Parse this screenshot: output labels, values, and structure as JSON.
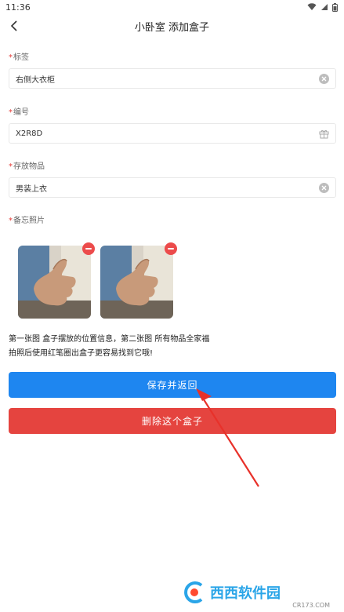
{
  "status": {
    "time": "11:36"
  },
  "header": {
    "title": "小卧室 添加盒子"
  },
  "form": {
    "required_mark": "*",
    "tag": {
      "label": "标签",
      "value": "右侧大衣柜"
    },
    "code": {
      "label": "编号",
      "value": "X2R8D"
    },
    "items": {
      "label": "存放物品",
      "value": "男装上衣"
    },
    "photos": {
      "label": "备忘照片"
    }
  },
  "hint": {
    "line1": "第一张图 盒子摆放的位置信息，第二张图 所有物品全家福",
    "line2": "拍照后使用红笔圈出盒子更容易找到它哦!"
  },
  "buttons": {
    "save": "保存并返回",
    "delete": "删除这个盒子"
  },
  "watermark": {
    "text": "西西软件园",
    "url": "CR173.COM"
  },
  "colors": {
    "save": "#1e86f0",
    "delete": "#e5443f",
    "required": "#e53935",
    "arrow": "#e8312a"
  }
}
